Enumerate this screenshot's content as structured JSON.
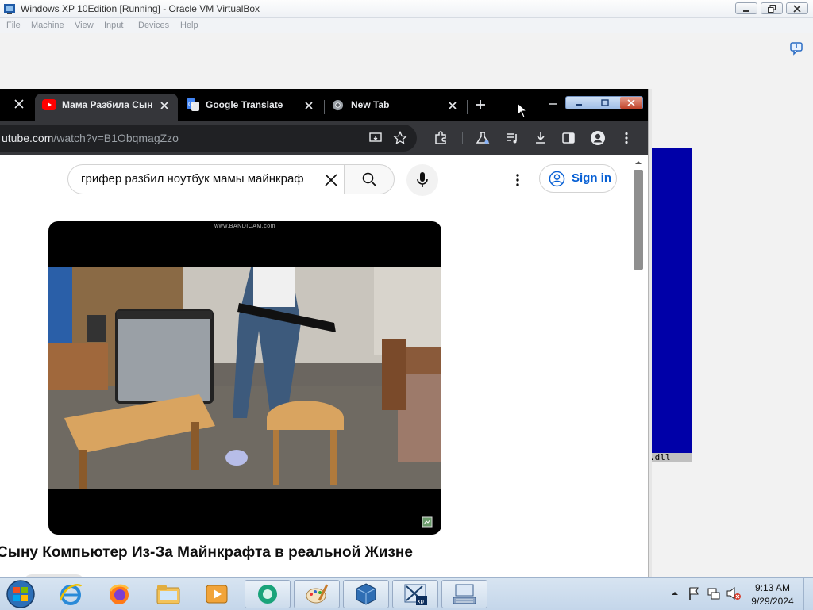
{
  "vbox": {
    "title": "Windows XP 10Edition [Running] - Oracle VM VirtualBox",
    "menu": [
      "File",
      "Machine",
      "View",
      "Input",
      "Devices",
      "Help"
    ]
  },
  "guest_window": {
    "status_text": ".dll"
  },
  "chrome": {
    "tabs": [
      {
        "title": "Мама Разбила Сын",
        "icon": "youtube-icon",
        "active": true
      },
      {
        "title": "Google Translate",
        "icon": "google-translate-icon",
        "active": false
      },
      {
        "title": "New Tab",
        "icon": "chrome-icon",
        "active": false
      }
    ],
    "url": {
      "host": "utube.com",
      "path": "/watch?v=B1ObqmagZzo"
    }
  },
  "youtube": {
    "search_query": "грифер разбил ноутбук мамы майнкраф",
    "sign_in_label": "Sign in",
    "video_watermark": "www.BANDICAM.com",
    "video_title": "Сыну Компьютер Из-За Майнкрафта в реальной Жизне"
  },
  "taskbar": {
    "time": "9:13 AM",
    "date": "9/29/2024",
    "apps": [
      "start-orb",
      "internet-explorer-icon",
      "firefox-icon",
      "file-explorer-icon",
      "media-player-icon",
      "chrome-remote-icon",
      "paint-icon",
      "virtualbox-icon",
      "windows-xp-icon",
      "keyboard-app-icon"
    ]
  },
  "colors": {
    "chrome_tabstrip": "#000000",
    "chrome_toolbar": "#35363a",
    "youtube_link": "#065fd4",
    "guest_blue": "#0000a8"
  }
}
